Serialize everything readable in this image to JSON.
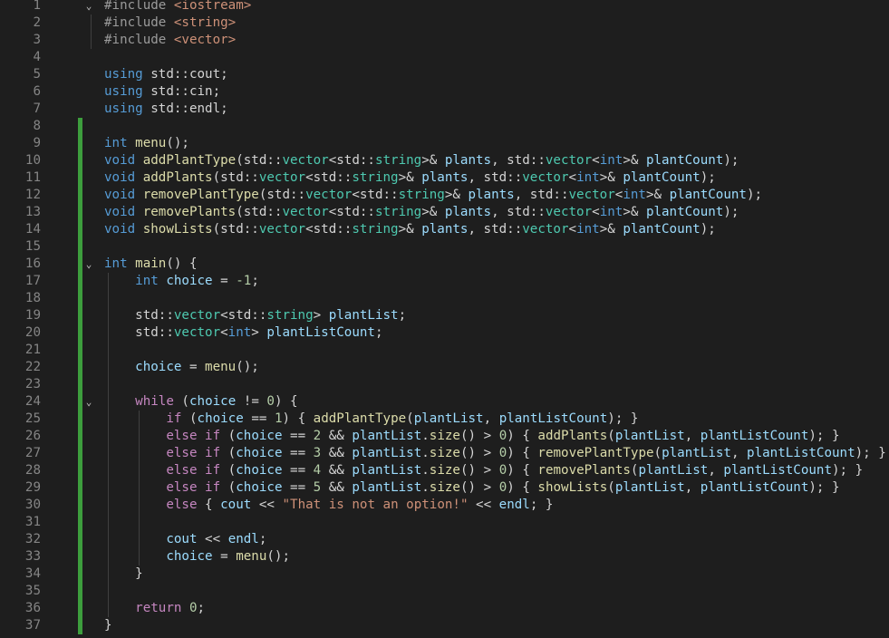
{
  "editor": {
    "lines": [
      {
        "num": "1",
        "tokens": [
          [
            "pp",
            "#include "
          ],
          [
            "s",
            "<iostream>"
          ]
        ]
      },
      {
        "num": "2",
        "tokens": [
          [
            "pp",
            "#include "
          ],
          [
            "s",
            "<string>"
          ]
        ]
      },
      {
        "num": "3",
        "tokens": [
          [
            "pp",
            "#include "
          ],
          [
            "s",
            "<vector>"
          ]
        ]
      },
      {
        "num": "4",
        "tokens": []
      },
      {
        "num": "5",
        "tokens": [
          [
            "k",
            "using "
          ],
          [
            "p",
            "std::"
          ],
          [
            "p",
            "cout;"
          ]
        ]
      },
      {
        "num": "6",
        "tokens": [
          [
            "k",
            "using "
          ],
          [
            "p",
            "std::"
          ],
          [
            "p",
            "cin;"
          ]
        ]
      },
      {
        "num": "7",
        "tokens": [
          [
            "k",
            "using "
          ],
          [
            "p",
            "std::"
          ],
          [
            "p",
            "endl;"
          ]
        ]
      },
      {
        "num": "8",
        "tokens": []
      },
      {
        "num": "9",
        "tokens": [
          [
            "k",
            "int "
          ],
          [
            "f",
            "menu"
          ],
          [
            "p",
            "();"
          ]
        ]
      },
      {
        "num": "10",
        "tokens": [
          [
            "k",
            "void "
          ],
          [
            "f",
            "addPlantType"
          ],
          [
            "p",
            "(std::"
          ],
          [
            "t",
            "vector"
          ],
          [
            "p",
            "<std::"
          ],
          [
            "t",
            "string"
          ],
          [
            "p",
            ">& "
          ],
          [
            "v",
            "plants"
          ],
          [
            "p",
            ", std::"
          ],
          [
            "t",
            "vector"
          ],
          [
            "p",
            "<"
          ],
          [
            "k",
            "int"
          ],
          [
            "p",
            ">& "
          ],
          [
            "v",
            "plantCount"
          ],
          [
            "p",
            ");"
          ]
        ]
      },
      {
        "num": "11",
        "tokens": [
          [
            "k",
            "void "
          ],
          [
            "f",
            "addPlants"
          ],
          [
            "p",
            "(std::"
          ],
          [
            "t",
            "vector"
          ],
          [
            "p",
            "<std::"
          ],
          [
            "t",
            "string"
          ],
          [
            "p",
            ">& "
          ],
          [
            "v",
            "plants"
          ],
          [
            "p",
            ", std::"
          ],
          [
            "t",
            "vector"
          ],
          [
            "p",
            "<"
          ],
          [
            "k",
            "int"
          ],
          [
            "p",
            ">& "
          ],
          [
            "v",
            "plantCount"
          ],
          [
            "p",
            ");"
          ]
        ]
      },
      {
        "num": "12",
        "tokens": [
          [
            "k",
            "void "
          ],
          [
            "f",
            "removePlantType"
          ],
          [
            "p",
            "(std::"
          ],
          [
            "t",
            "vector"
          ],
          [
            "p",
            "<std::"
          ],
          [
            "t",
            "string"
          ],
          [
            "p",
            ">& "
          ],
          [
            "v",
            "plants"
          ],
          [
            "p",
            ", std::"
          ],
          [
            "t",
            "vector"
          ],
          [
            "p",
            "<"
          ],
          [
            "k",
            "int"
          ],
          [
            "p",
            ">& "
          ],
          [
            "v",
            "plantCount"
          ],
          [
            "p",
            ");"
          ]
        ]
      },
      {
        "num": "13",
        "tokens": [
          [
            "k",
            "void "
          ],
          [
            "f",
            "removePlants"
          ],
          [
            "p",
            "(std::"
          ],
          [
            "t",
            "vector"
          ],
          [
            "p",
            "<std::"
          ],
          [
            "t",
            "string"
          ],
          [
            "p",
            ">& "
          ],
          [
            "v",
            "plants"
          ],
          [
            "p",
            ", std::"
          ],
          [
            "t",
            "vector"
          ],
          [
            "p",
            "<"
          ],
          [
            "k",
            "int"
          ],
          [
            "p",
            ">& "
          ],
          [
            "v",
            "plantCount"
          ],
          [
            "p",
            ");"
          ]
        ]
      },
      {
        "num": "14",
        "tokens": [
          [
            "k",
            "void "
          ],
          [
            "f",
            "showLists"
          ],
          [
            "p",
            "(std::"
          ],
          [
            "t",
            "vector"
          ],
          [
            "p",
            "<std::"
          ],
          [
            "t",
            "string"
          ],
          [
            "p",
            ">& "
          ],
          [
            "v",
            "plants"
          ],
          [
            "p",
            ", std::"
          ],
          [
            "t",
            "vector"
          ],
          [
            "p",
            "<"
          ],
          [
            "k",
            "int"
          ],
          [
            "p",
            ">& "
          ],
          [
            "v",
            "plantCount"
          ],
          [
            "p",
            ");"
          ]
        ]
      },
      {
        "num": "15",
        "tokens": []
      },
      {
        "num": "16",
        "tokens": [
          [
            "k",
            "int "
          ],
          [
            "f",
            "main"
          ],
          [
            "p",
            "() {"
          ]
        ]
      },
      {
        "num": "17",
        "tokens": [
          [
            "p",
            "    "
          ],
          [
            "k",
            "int "
          ],
          [
            "v",
            "choice"
          ],
          [
            "p",
            " = "
          ],
          [
            "n",
            "-1"
          ],
          [
            "p",
            ";"
          ]
        ]
      },
      {
        "num": "18",
        "tokens": []
      },
      {
        "num": "19",
        "tokens": [
          [
            "p",
            "    std::"
          ],
          [
            "t",
            "vector"
          ],
          [
            "p",
            "<std::"
          ],
          [
            "t",
            "string"
          ],
          [
            "p",
            "> "
          ],
          [
            "v",
            "plantList"
          ],
          [
            "p",
            ";"
          ]
        ]
      },
      {
        "num": "20",
        "tokens": [
          [
            "p",
            "    std::"
          ],
          [
            "t",
            "vector"
          ],
          [
            "p",
            "<"
          ],
          [
            "k",
            "int"
          ],
          [
            "p",
            "> "
          ],
          [
            "v",
            "plantListCount"
          ],
          [
            "p",
            ";"
          ]
        ]
      },
      {
        "num": "21",
        "tokens": []
      },
      {
        "num": "22",
        "tokens": [
          [
            "p",
            "    "
          ],
          [
            "v",
            "choice"
          ],
          [
            "p",
            " = "
          ],
          [
            "f",
            "menu"
          ],
          [
            "p",
            "();"
          ]
        ]
      },
      {
        "num": "23",
        "tokens": []
      },
      {
        "num": "24",
        "tokens": [
          [
            "p",
            "    "
          ],
          [
            "c",
            "while"
          ],
          [
            "p",
            " ("
          ],
          [
            "v",
            "choice"
          ],
          [
            "p",
            " != "
          ],
          [
            "n",
            "0"
          ],
          [
            "p",
            ") {"
          ]
        ]
      },
      {
        "num": "25",
        "tokens": [
          [
            "p",
            "        "
          ],
          [
            "c",
            "if"
          ],
          [
            "p",
            " ("
          ],
          [
            "v",
            "choice"
          ],
          [
            "p",
            " == "
          ],
          [
            "n",
            "1"
          ],
          [
            "p",
            ") { "
          ],
          [
            "f",
            "addPlantType"
          ],
          [
            "p",
            "("
          ],
          [
            "v",
            "plantList"
          ],
          [
            "p",
            ", "
          ],
          [
            "v",
            "plantListCount"
          ],
          [
            "p",
            "); }"
          ]
        ]
      },
      {
        "num": "26",
        "tokens": [
          [
            "p",
            "        "
          ],
          [
            "c",
            "else if"
          ],
          [
            "p",
            " ("
          ],
          [
            "v",
            "choice"
          ],
          [
            "p",
            " == "
          ],
          [
            "n",
            "2"
          ],
          [
            "p",
            " && "
          ],
          [
            "v",
            "plantList"
          ],
          [
            "p",
            "."
          ],
          [
            "f",
            "size"
          ],
          [
            "p",
            "() > "
          ],
          [
            "n",
            "0"
          ],
          [
            "p",
            ") { "
          ],
          [
            "f",
            "addPlants"
          ],
          [
            "p",
            "("
          ],
          [
            "v",
            "plantList"
          ],
          [
            "p",
            ", "
          ],
          [
            "v",
            "plantListCount"
          ],
          [
            "p",
            "); }"
          ]
        ]
      },
      {
        "num": "27",
        "tokens": [
          [
            "p",
            "        "
          ],
          [
            "c",
            "else if"
          ],
          [
            "p",
            " ("
          ],
          [
            "v",
            "choice"
          ],
          [
            "p",
            " == "
          ],
          [
            "n",
            "3"
          ],
          [
            "p",
            " && "
          ],
          [
            "v",
            "plantList"
          ],
          [
            "p",
            "."
          ],
          [
            "f",
            "size"
          ],
          [
            "p",
            "() > "
          ],
          [
            "n",
            "0"
          ],
          [
            "p",
            ") { "
          ],
          [
            "f",
            "removePlantType"
          ],
          [
            "p",
            "("
          ],
          [
            "v",
            "plantList"
          ],
          [
            "p",
            ", "
          ],
          [
            "v",
            "plantListCount"
          ],
          [
            "p",
            "); }"
          ]
        ]
      },
      {
        "num": "28",
        "tokens": [
          [
            "p",
            "        "
          ],
          [
            "c",
            "else if"
          ],
          [
            "p",
            " ("
          ],
          [
            "v",
            "choice"
          ],
          [
            "p",
            " == "
          ],
          [
            "n",
            "4"
          ],
          [
            "p",
            " && "
          ],
          [
            "v",
            "plantList"
          ],
          [
            "p",
            "."
          ],
          [
            "f",
            "size"
          ],
          [
            "p",
            "() > "
          ],
          [
            "n",
            "0"
          ],
          [
            "p",
            ") { "
          ],
          [
            "f",
            "removePlants"
          ],
          [
            "p",
            "("
          ],
          [
            "v",
            "plantList"
          ],
          [
            "p",
            ", "
          ],
          [
            "v",
            "plantListCount"
          ],
          [
            "p",
            "); }"
          ]
        ]
      },
      {
        "num": "29",
        "tokens": [
          [
            "p",
            "        "
          ],
          [
            "c",
            "else if"
          ],
          [
            "p",
            " ("
          ],
          [
            "v",
            "choice"
          ],
          [
            "p",
            " == "
          ],
          [
            "n",
            "5"
          ],
          [
            "p",
            " && "
          ],
          [
            "v",
            "plantList"
          ],
          [
            "p",
            "."
          ],
          [
            "f",
            "size"
          ],
          [
            "p",
            "() > "
          ],
          [
            "n",
            "0"
          ],
          [
            "p",
            ") { "
          ],
          [
            "f",
            "showLists"
          ],
          [
            "p",
            "("
          ],
          [
            "v",
            "plantList"
          ],
          [
            "p",
            ", "
          ],
          [
            "v",
            "plantListCount"
          ],
          [
            "p",
            "); }"
          ]
        ]
      },
      {
        "num": "30",
        "tokens": [
          [
            "p",
            "        "
          ],
          [
            "c",
            "else"
          ],
          [
            "p",
            " { "
          ],
          [
            "v",
            "cout"
          ],
          [
            "p",
            " << "
          ],
          [
            "s",
            "\"That is not an option!\""
          ],
          [
            "p",
            " << "
          ],
          [
            "v",
            "endl"
          ],
          [
            "p",
            "; }"
          ]
        ]
      },
      {
        "num": "31",
        "tokens": []
      },
      {
        "num": "32",
        "tokens": [
          [
            "p",
            "        "
          ],
          [
            "v",
            "cout"
          ],
          [
            "p",
            " << "
          ],
          [
            "v",
            "endl"
          ],
          [
            "p",
            ";"
          ]
        ]
      },
      {
        "num": "33",
        "tokens": [
          [
            "p",
            "        "
          ],
          [
            "v",
            "choice"
          ],
          [
            "p",
            " = "
          ],
          [
            "f",
            "menu"
          ],
          [
            "p",
            "();"
          ]
        ]
      },
      {
        "num": "34",
        "tokens": [
          [
            "p",
            "    }"
          ]
        ]
      },
      {
        "num": "35",
        "tokens": []
      },
      {
        "num": "36",
        "tokens": [
          [
            "p",
            "    "
          ],
          [
            "c",
            "return"
          ],
          [
            "p",
            " "
          ],
          [
            "n",
            "0"
          ],
          [
            "p",
            ";"
          ]
        ]
      },
      {
        "num": "37",
        "tokens": [
          [
            "p",
            "}"
          ]
        ]
      }
    ],
    "fold_markers": {
      "1": "⌄",
      "16": "⌄",
      "24": "⌄"
    },
    "modified_lines_from": 8,
    "modified_lines_to": 37
  }
}
